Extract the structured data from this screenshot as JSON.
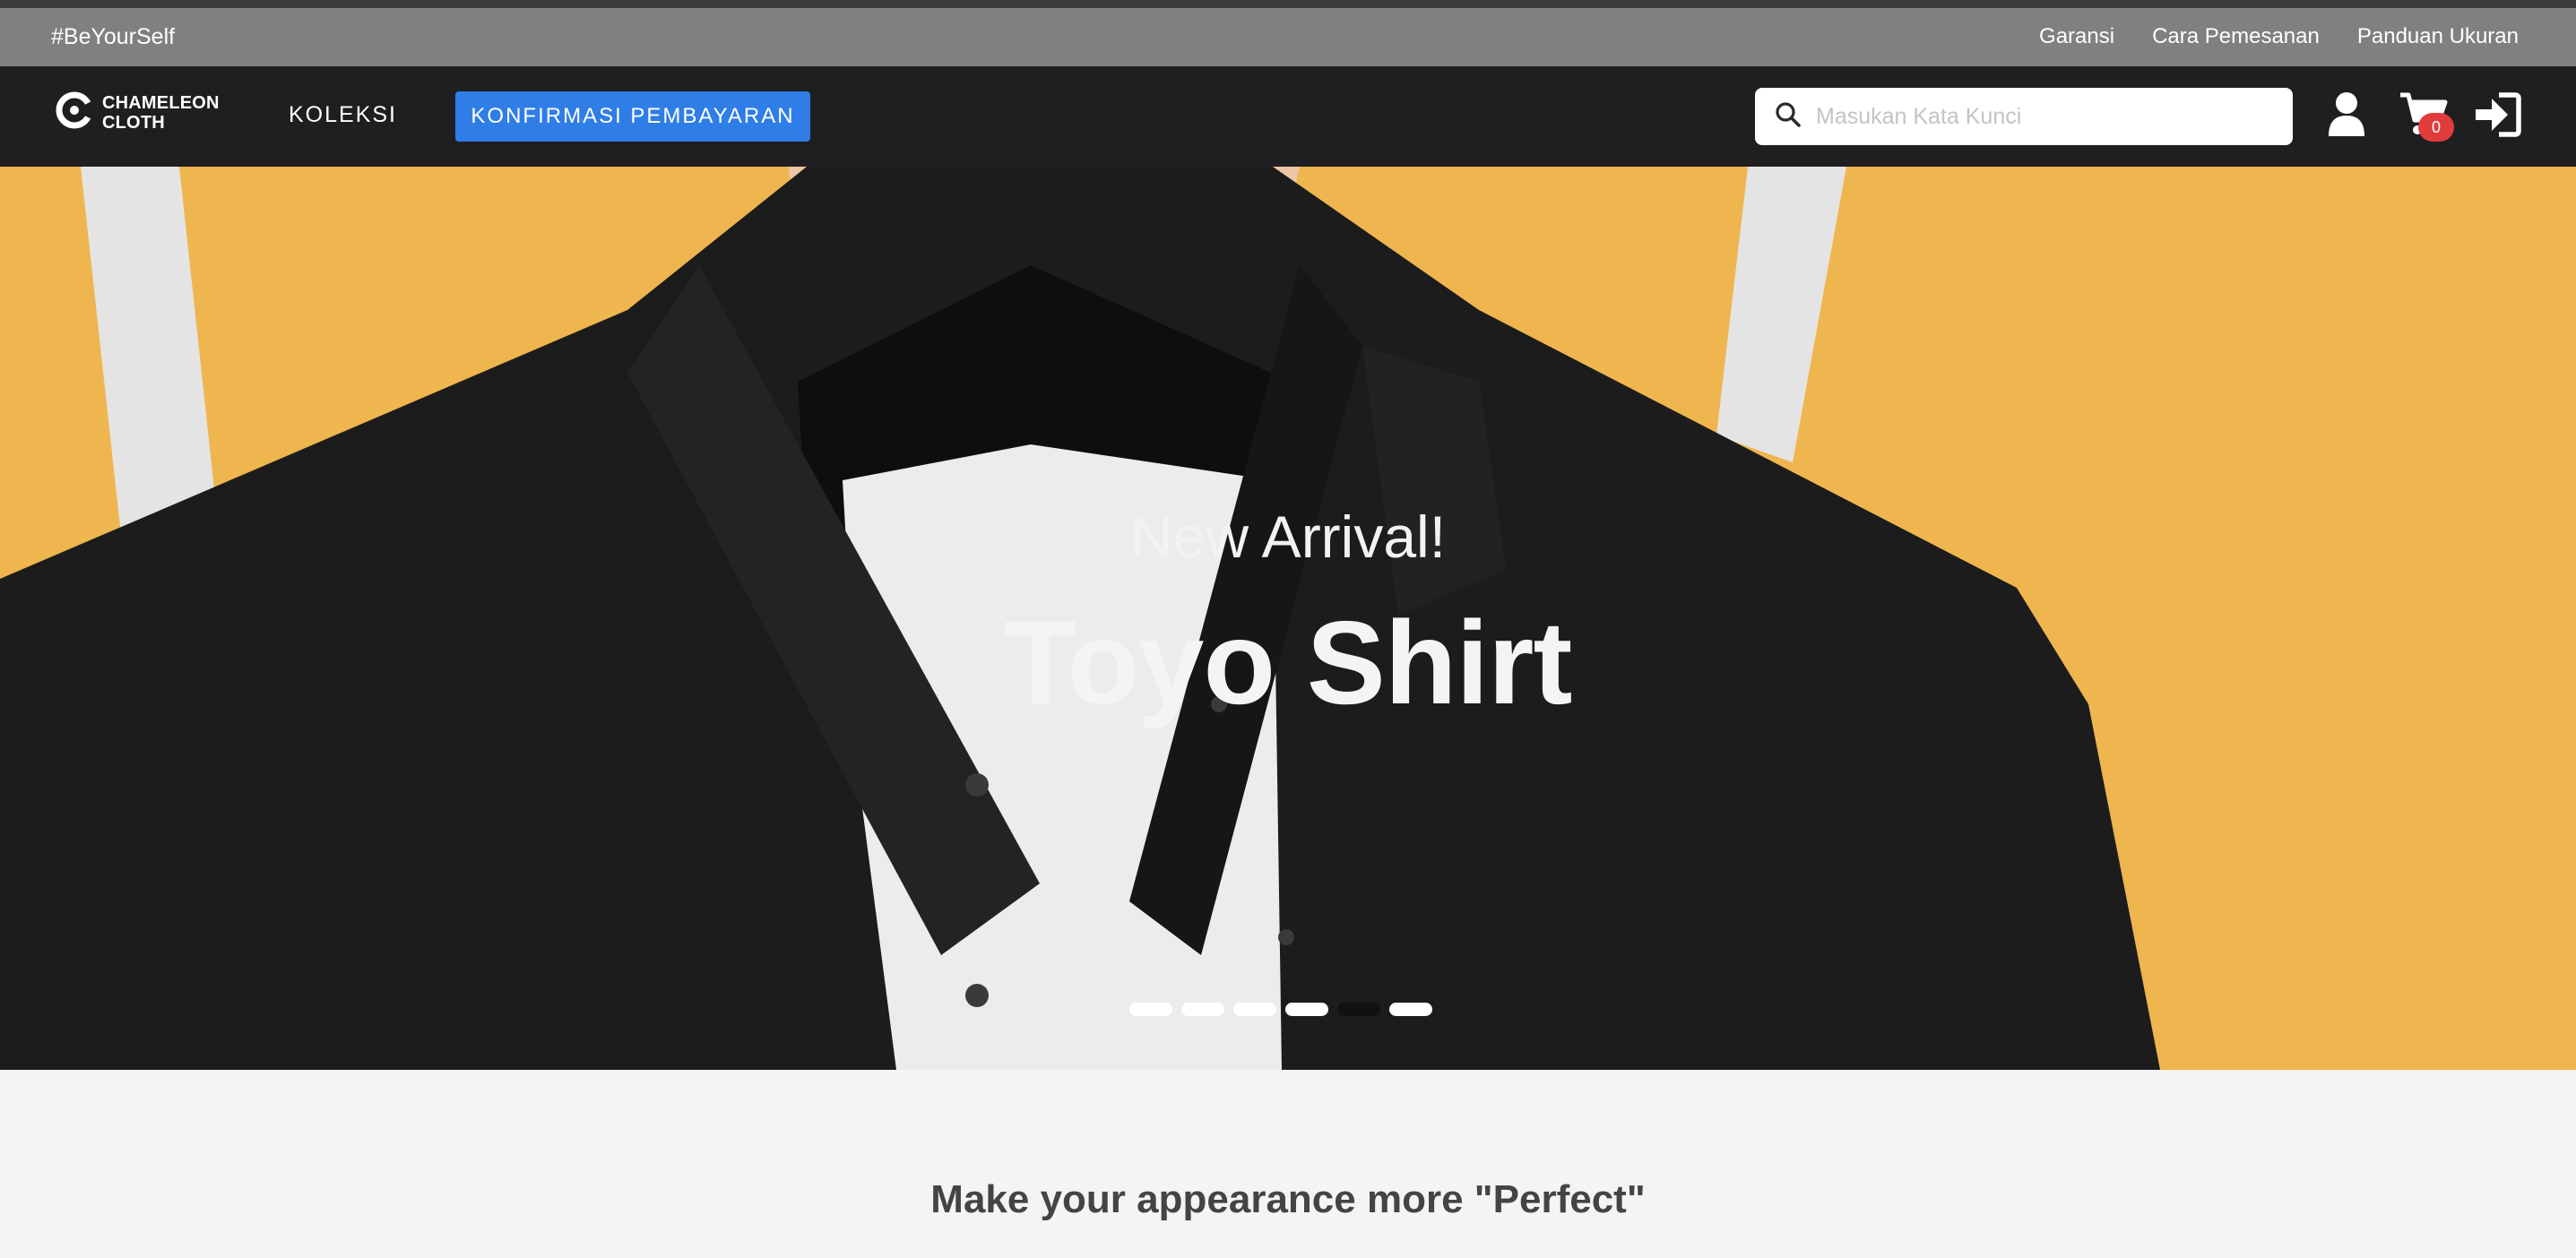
{
  "topbar": {
    "tagline": "#BeYourSelf",
    "links": [
      "Garansi",
      "Cara Pemesanan",
      "Panduan Ukuran"
    ]
  },
  "navbar": {
    "logo": {
      "line1": "CHAMELEON",
      "line2": "CLOTH",
      "icon": "chameleon-logo-icon"
    },
    "koleksi_label": "KOLEKSI",
    "confirm_label": "KONFIRMASI PEMBAYARAN",
    "search": {
      "placeholder": "Masukan Kata Kunci",
      "value": "",
      "icon": "search-icon"
    },
    "cart_count": "0",
    "icons": [
      "user-icon",
      "cart-icon",
      "login-icon"
    ],
    "confirm_color": "#2f7de6",
    "badge_color": "#e23b3b"
  },
  "hero": {
    "subtitle": "New Arrival!",
    "title": "Toyo Shirt",
    "slide_count": 6,
    "active_slide": 5,
    "background_color": "#efb54f"
  },
  "section": {
    "title": "Make your appearance more \"Perfect\""
  }
}
